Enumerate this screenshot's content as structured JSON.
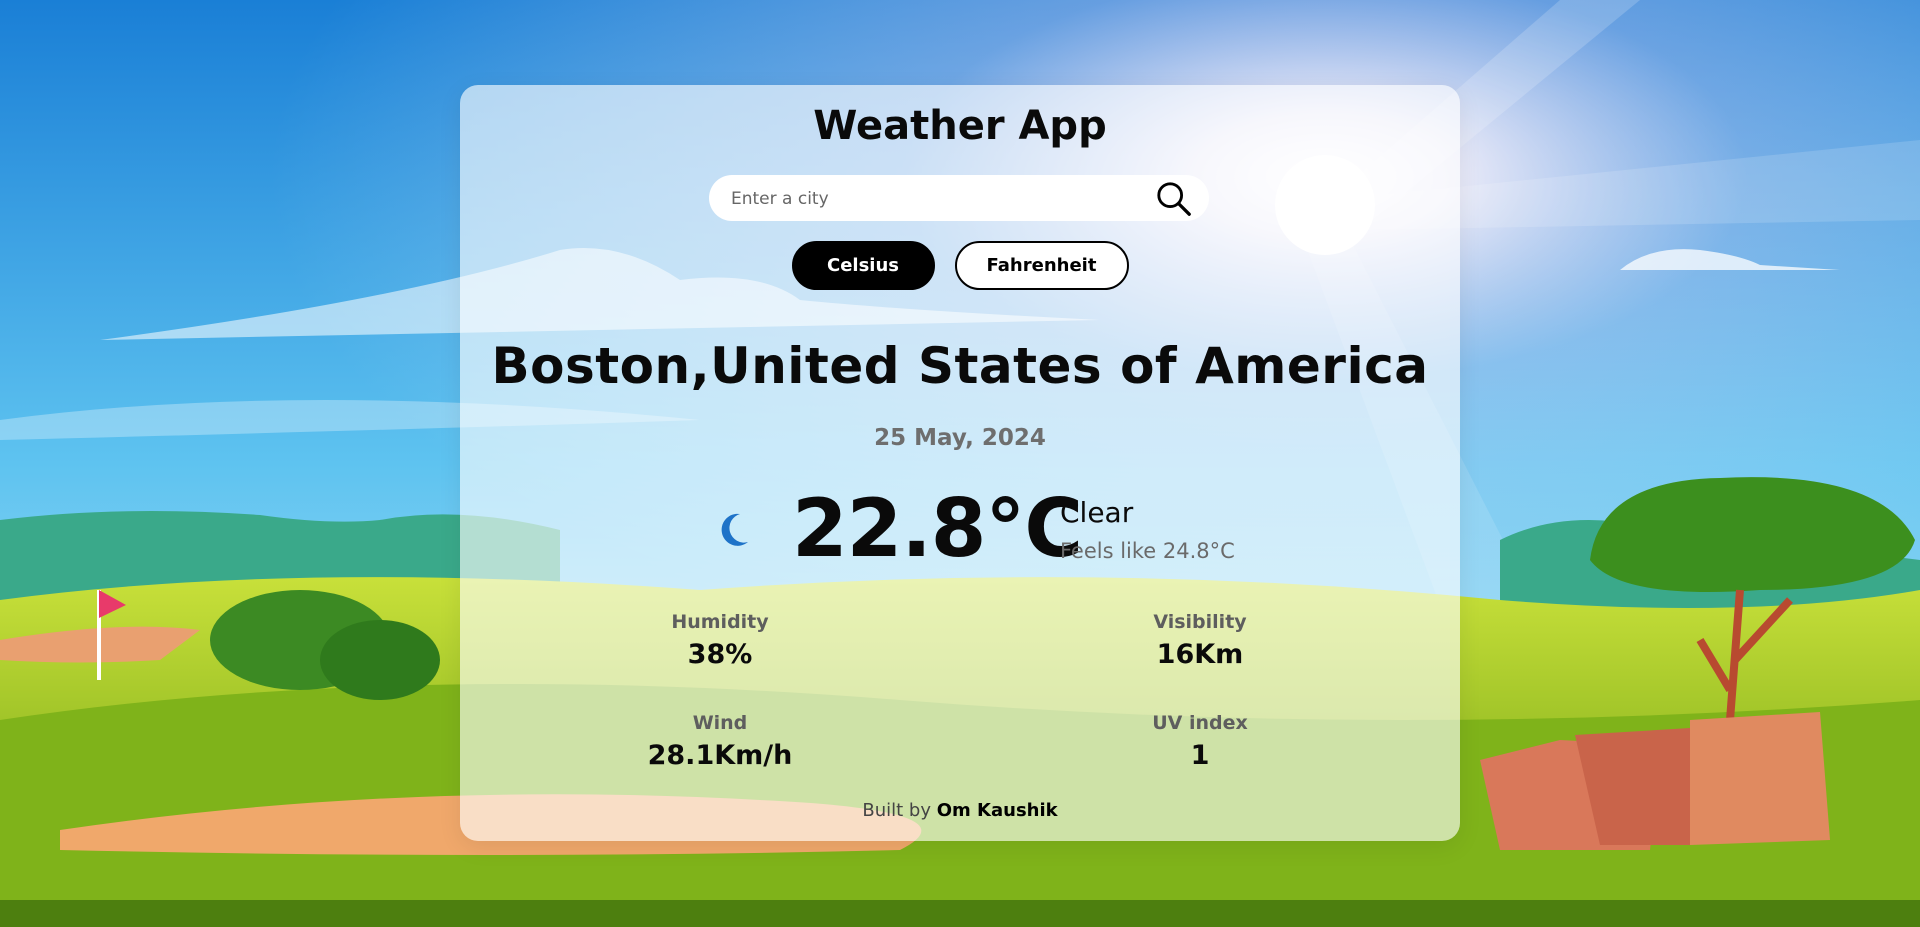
{
  "app": {
    "title": "Weather App"
  },
  "search": {
    "placeholder": "Enter a city",
    "value": "",
    "icon": "search-icon"
  },
  "units": {
    "celsius_label": "Celsius",
    "fahrenheit_label": "Fahrenheit",
    "selected": "Celsius"
  },
  "location": {
    "name": "Boston,United States of America"
  },
  "date": "25 May, 2024",
  "current": {
    "icon": "crescent-moon-icon",
    "icon_color": "#1e73c8",
    "temperature": "22.8°C",
    "condition": "Clear",
    "feels_like": "Feels like 24.8°C"
  },
  "metrics": {
    "humidity": {
      "label": "Humidity",
      "value": "38%"
    },
    "visibility": {
      "label": "Visibility",
      "value": "16Km"
    },
    "wind": {
      "label": "Wind",
      "value": "28.1Km/h"
    },
    "uv": {
      "label": "UV index",
      "value": "1"
    }
  },
  "footer": {
    "prefix": "Built by",
    "author": "Om Kaushik"
  },
  "colors": {
    "sky_top": "#1a7fd6",
    "grass": "#8fbf1a",
    "accent": "#000000"
  }
}
